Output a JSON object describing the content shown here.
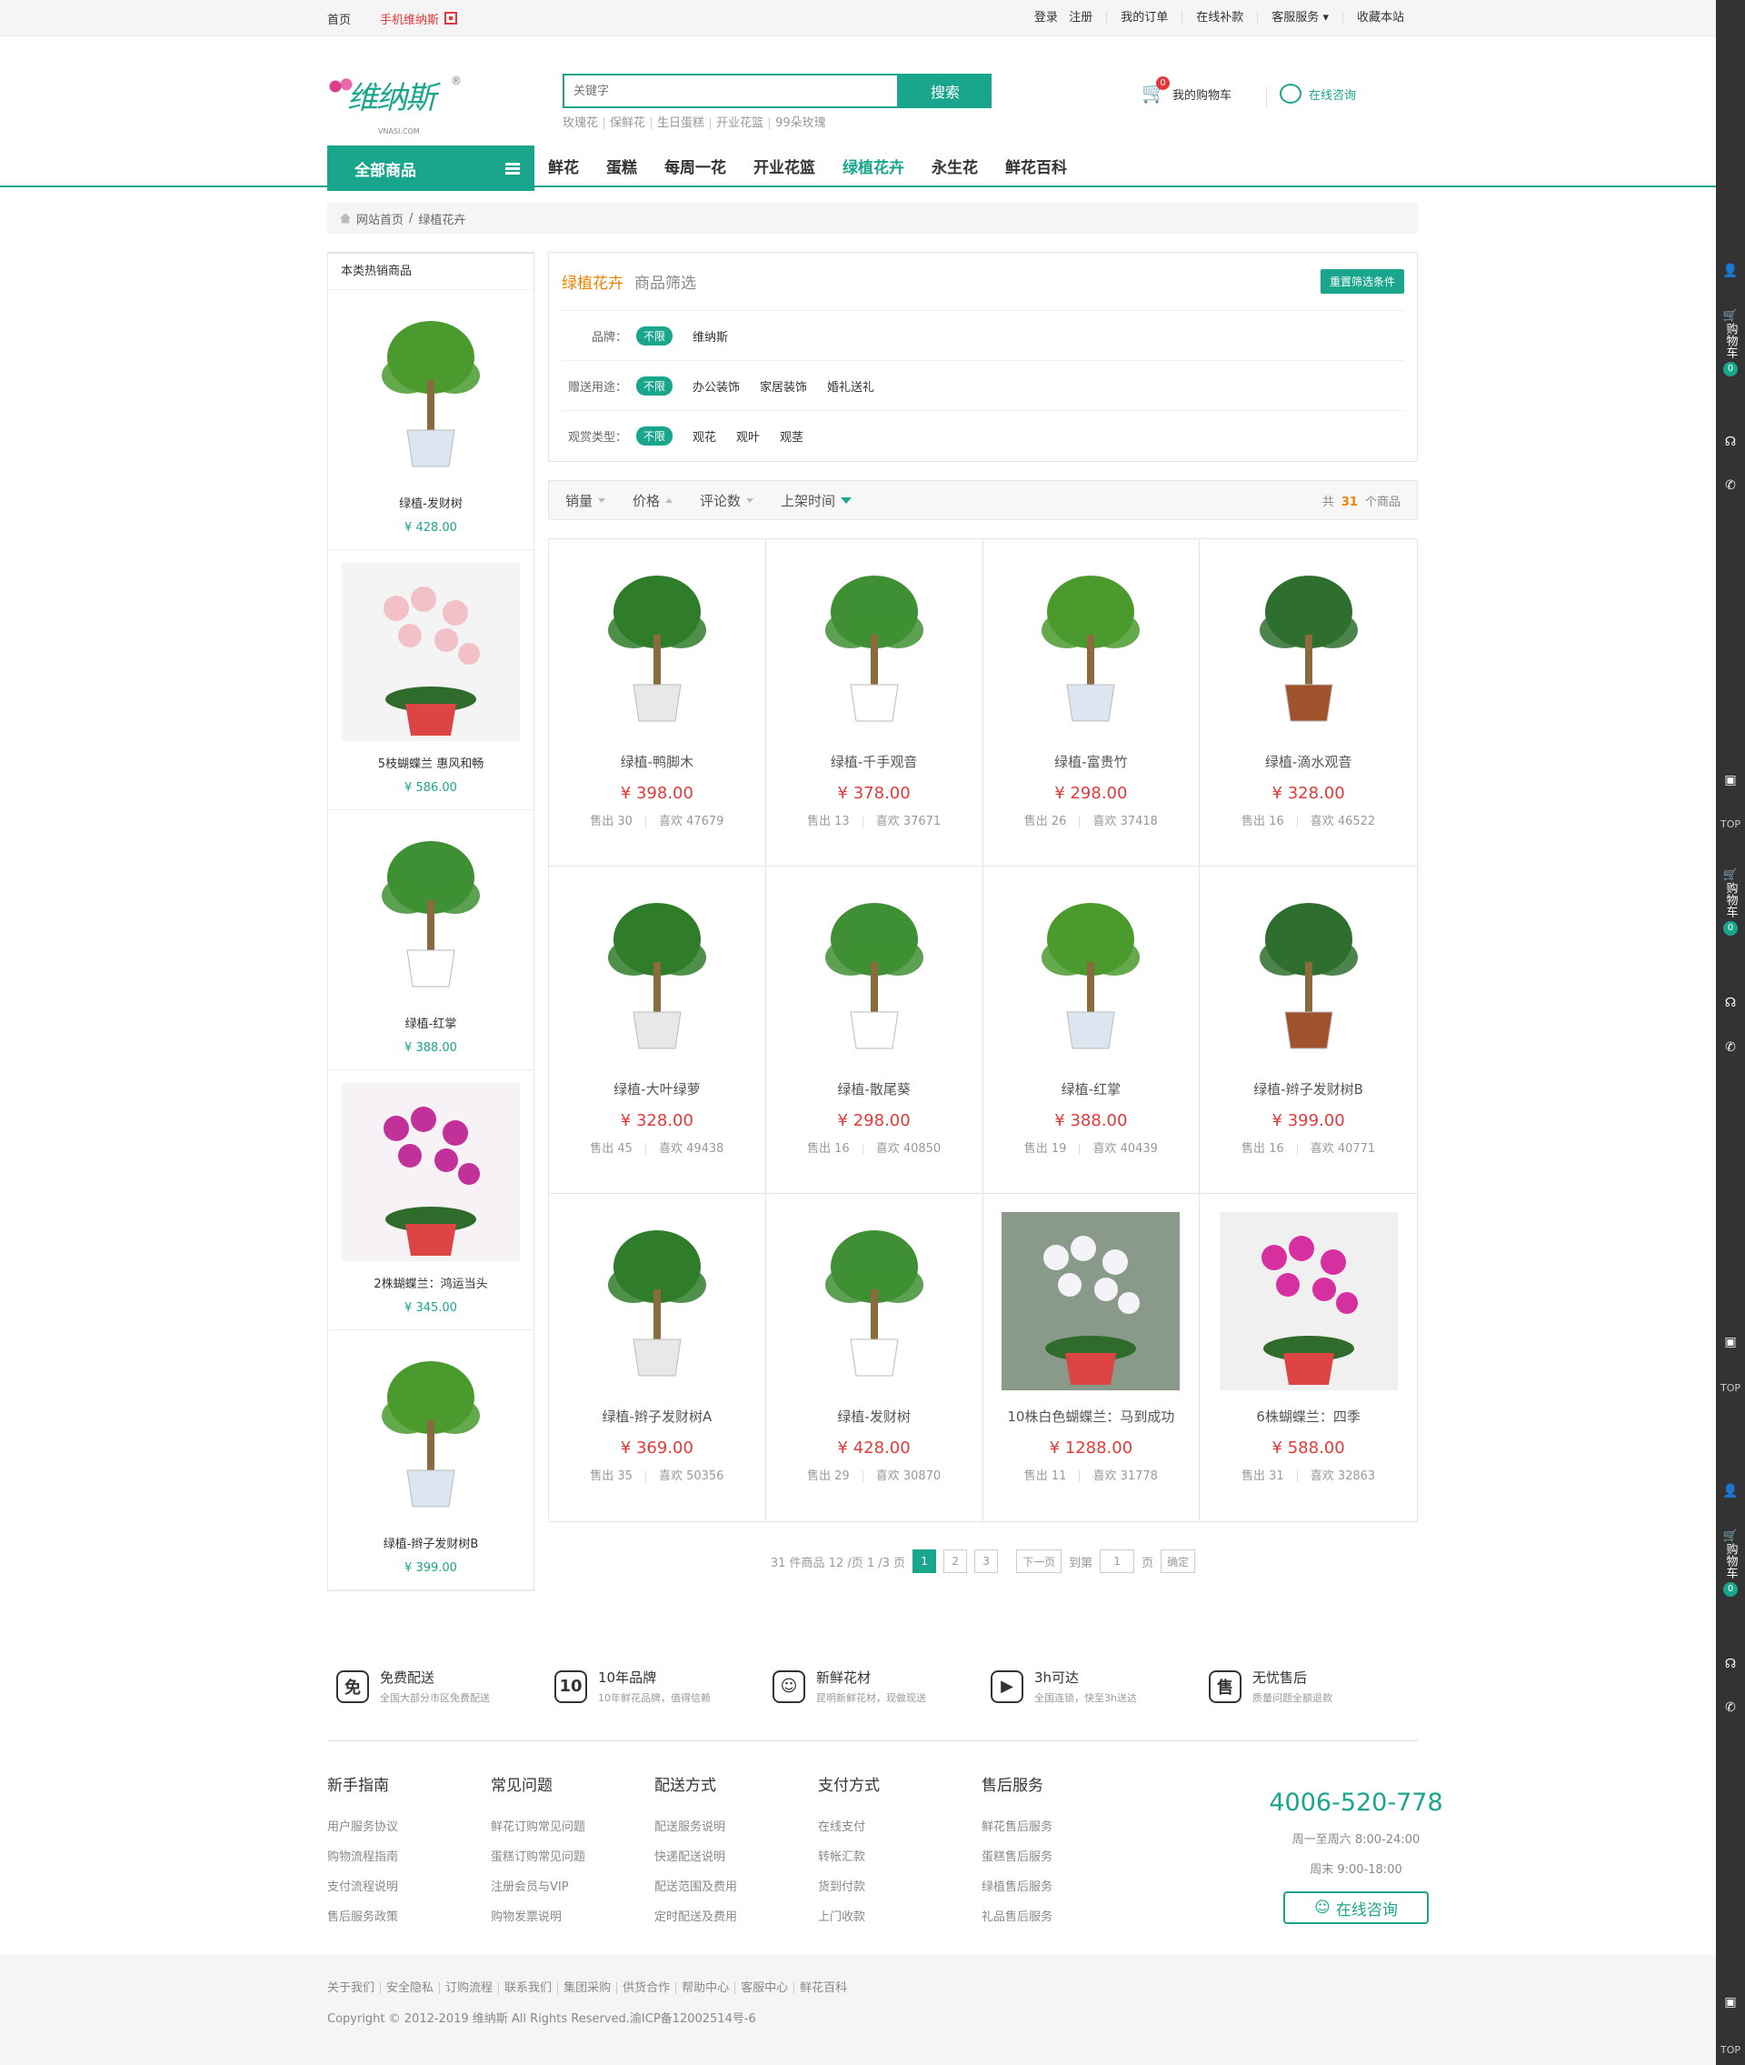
{
  "topbar": {
    "home": "首页",
    "mobile": "手机维纳斯",
    "login": "登录",
    "register": "注册",
    "orders": "我的订单",
    "pay": "在线补款",
    "service": "客服服务",
    "fav": "收藏本站"
  },
  "header": {
    "logo": "维纳斯",
    "logo_sub": "VNASI.COM",
    "logo_reg": "®",
    "search_placeholder": "关键字",
    "search_btn": "搜索",
    "hot": [
      "玫瑰花",
      "保鲜花",
      "生日蛋糕",
      "开业花篮",
      "99朵玫瑰"
    ],
    "cart": "我的购物车",
    "cart_count": "0",
    "consult": "在线咨询"
  },
  "nav": {
    "all": "全部商品",
    "items": [
      "鲜花",
      "蛋糕",
      "每周一花",
      "开业花篮",
      "绿植花卉",
      "永生花",
      "鲜花百科"
    ]
  },
  "crumb": {
    "home": "网站首页",
    "sep": "/",
    "current": "绿植花卉"
  },
  "side": {
    "title": "本类热销商品",
    "items": [
      {
        "name": "绿植-发财树",
        "price": "¥ 428.00"
      },
      {
        "name": "5枝蝴蝶兰 惠风和畅",
        "price": "¥ 586.00"
      },
      {
        "name": "绿植-红掌",
        "price": "¥ 388.00"
      },
      {
        "name": "2株蝴蝶兰：鸿运当头",
        "price": "¥ 345.00"
      },
      {
        "name": "绿植-辫子发财树B",
        "price": "¥ 399.00"
      }
    ]
  },
  "filter": {
    "cat": "绿植花卉",
    "label": "商品筛选",
    "reset": "重置筛选条件",
    "rows": [
      {
        "k": "品牌：",
        "all": "不限",
        "v": [
          "维纳斯"
        ]
      },
      {
        "k": "赠送用途：",
        "all": "不限",
        "v": [
          "办公装饰",
          "家居装饰",
          "婚礼送礼"
        ]
      },
      {
        "k": "观赏类型：",
        "all": "不限",
        "v": [
          "观花",
          "观叶",
          "观茎"
        ]
      }
    ]
  },
  "sort": {
    "items": [
      "销量",
      "价格",
      "评论数",
      "上架时间"
    ],
    "tot_pre": "共",
    "tot": "31",
    "tot_suf": "个商品"
  },
  "products": [
    {
      "name": "绿植-鸭脚木",
      "price": "¥ 398.00",
      "sold": "售出 30",
      "like": "喜欢 47679"
    },
    {
      "name": "绿植-千手观音",
      "price": "¥ 378.00",
      "sold": "售出 13",
      "like": "喜欢 37671"
    },
    {
      "name": "绿植-富贵竹",
      "price": "¥ 298.00",
      "sold": "售出 26",
      "like": "喜欢 37418"
    },
    {
      "name": "绿植-滴水观音",
      "price": "¥ 328.00",
      "sold": "售出 16",
      "like": "喜欢 46522"
    },
    {
      "name": "绿植-大叶绿萝",
      "price": "¥ 328.00",
      "sold": "售出 45",
      "like": "喜欢 49438"
    },
    {
      "name": "绿植-散尾葵",
      "price": "¥ 298.00",
      "sold": "售出 16",
      "like": "喜欢 40850"
    },
    {
      "name": "绿植-红掌",
      "price": "¥ 388.00",
      "sold": "售出 19",
      "like": "喜欢 40439"
    },
    {
      "name": "绿植-辫子发财树B",
      "price": "¥ 399.00",
      "sold": "售出 16",
      "like": "喜欢 40771"
    },
    {
      "name": "绿植-辫子发财树A",
      "price": "¥ 369.00",
      "sold": "售出 35",
      "like": "喜欢 50356"
    },
    {
      "name": "绿植-发财树",
      "price": "¥ 428.00",
      "sold": "售出 29",
      "like": "喜欢 30870"
    },
    {
      "name": "10株白色蝴蝶兰：马到成功",
      "price": "¥ 1288.00",
      "sold": "售出 11",
      "like": "喜欢 31778"
    },
    {
      "name": "6株蝴蝶兰：四季",
      "price": "¥ 588.00",
      "sold": "售出 31",
      "like": "喜欢 32863"
    }
  ],
  "pager": {
    "info": "31 件商品 12 /页 1 /3 页",
    "pages": [
      "1",
      "2",
      "3"
    ],
    "next": "下一页",
    "goto": "到第",
    "page_val": "1",
    "page": "页",
    "ok": "确定"
  },
  "services": [
    {
      "icon": "免",
      "t": "免费配送",
      "d": "全国大部分市区免费配送"
    },
    {
      "icon": "10",
      "t": "10年品牌",
      "d": "10年鲜花品牌，值得信赖"
    },
    {
      "icon": "☺",
      "t": "新鲜花材",
      "d": "昆明新鲜花材，现做现送"
    },
    {
      "icon": "▶",
      "t": "3h可达",
      "d": "全国连锁，快至3h送达"
    },
    {
      "icon": "售",
      "t": "无忧售后",
      "d": "质量问题全额退款"
    }
  ],
  "footlinks": [
    {
      "h": "新手指南",
      "l": [
        "用户服务协议",
        "购物流程指南",
        "支付流程说明",
        "售后服务政策"
      ]
    },
    {
      "h": "常见问题",
      "l": [
        "鲜花订购常见问题",
        "蛋糕订购常见问题",
        "注册会员与VIP",
        "购物发票说明"
      ]
    },
    {
      "h": "配送方式",
      "l": [
        "配送服务说明",
        "快递配送说明",
        "配送范围及费用",
        "定时配送及费用"
      ]
    },
    {
      "h": "支付方式",
      "l": [
        "在线支付",
        "转帐汇款",
        "货到付款",
        "上门收款"
      ]
    },
    {
      "h": "售后服务",
      "l": [
        "鲜花售后服务",
        "蛋糕售后服务",
        "绿植售后服务",
        "礼品售后服务"
      ]
    }
  ],
  "hotline": {
    "tel": "4006-520-778",
    "t1": "周一至周六 8:00-24:00",
    "t2": "周末 9:00-18:00",
    "btn": "在线咨询"
  },
  "bottom": {
    "links": [
      "关于我们",
      "安全隐私",
      "订购流程",
      "联系我们",
      "集团采购",
      "供货合作",
      "帮助中心",
      "客服中心",
      "鲜花百科"
    ],
    "copy": "Copyright © 2012-2019 维纳斯 All Rights Reserved.渝ICP备12002514号-6"
  },
  "rbar": {
    "cart": "购物车",
    "count": "0",
    "top": "TOP"
  }
}
